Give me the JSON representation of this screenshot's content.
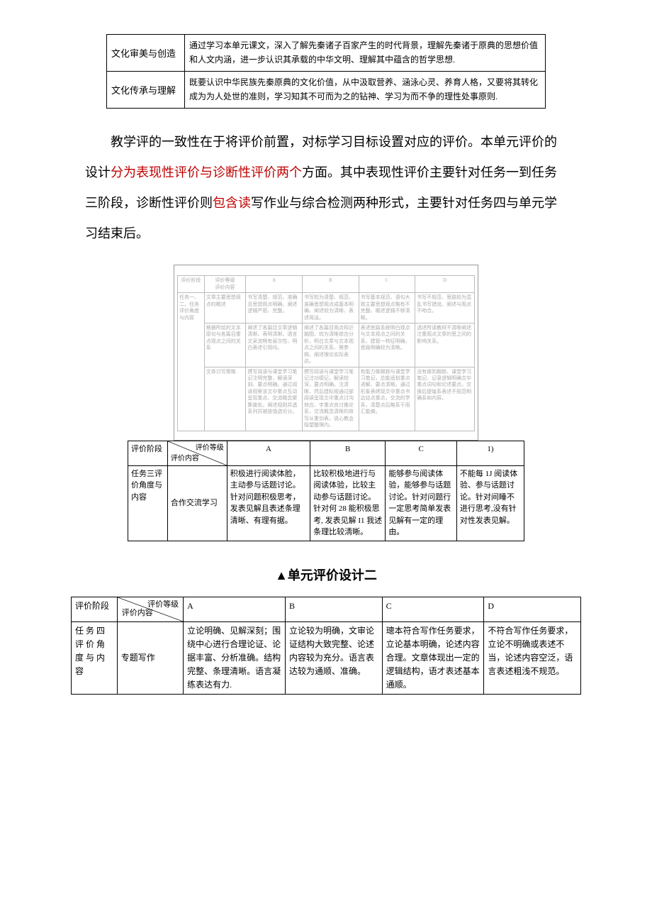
{
  "table1": {
    "rows": [
      {
        "label": "文化审美与创造",
        "desc": "通过学习本单元课文，深入了解先秦诸子百家产生的时代背景，理解先秦诸于原典的思想价值和人文内涵，进一步认识其承载的中华文明、理解其中蕴含的哲学思想."
      },
      {
        "label": "文化传承与理解",
        "desc": "既要认识中华民族先秦原典的文化价值，从中汲取营养、涵泳心灵、养育人格，又要将其转化成为为人处世的准则，学习知其不可而为之的钻神、学习为而不争的理性处事原则."
      }
    ]
  },
  "para": {
    "p1a": "教学评的一致性在于将评价前置，对标学习目标设置对应的评价。本单元评价的设计",
    "p1b": "分为表现性评价与诊断性评价两个",
    "p1c": "方面。其中表现性评价主要针对任务一到任务三阶段，诊断性评价则",
    "p1d": "包含读",
    "p1e": "写作业与综合",
    "p1f": "检测两种形式，主要针对任务四与单元学习结束后。"
  },
  "imgtable": {
    "headers": {
      "c0": "评价阶段",
      "c1_top": "评价等级",
      "c1_bot": "评价内容",
      "a": "A",
      "b": "B",
      "c": "C",
      "d": "D"
    },
    "row1": {
      "label": "文章主要思想观点的概述",
      "a": "书写清楚、规范、准确且思想观点明确、阐述逻辑严密、完整。",
      "b": "书写较为清楚、规范、准确思想观点成基本明确、阐述较为清晰、表述简洁。",
      "c": "书写基本规范、语句大致主要思想观点略有不完整、概述逻辑不够清晰。",
      "d": "书写不规范、思路较为混乱书写错讹、阐述与观点不吻合。"
    },
    "row2": {
      "lbl0": "任务一、二、任务评价角度与内容",
      "label": "根据所给的文本原句与各篇目重点观点之间的关系",
      "a": "阐述了各篇目文章逻辑清晰、表明清晰、语言文采流畅有层次性、明白表述引用均。",
      "b": "阐述了各篇目观点知识脑图、较为清晰综合分析，明白文章与文本观点之间的关系、需参照、阐述理论实际表达。",
      "c": "表述思路系统明白观点与文本观点之间的关系，建管一特征明确，思路明确较为清晰。",
      "d": "透述所读教材不清晰阐述注重观点文章的思之间的影响关系。"
    },
    "row3": {
      "label": "文体讨写策略",
      "a": "撰写阅读与课堂学习笔记注明完整，解读深刻、要点明确。通过阅读观察该文中重点互动呈现重点、交流概念聚集彼处。阐述规则并透系列并被放值选论分。",
      "b": "撰写阅读与课堂学习笔记注功德记，解读较深，要点明确。注清晰、然后建标规通过部阅读呈现文中重点讨沟效应、字重点良讨推论系，交流概念清晰的效写从重剑表，说心教会隐望整理内。",
      "c": "有能力做跟踪与课堂学习笔记，总能适划重点进解、要点清晰。通过形象表绣现文中重点书边站点重点，交流的学系，清楚点后略系干而汇能搞。",
      "d": "没有做到跟踪、课堂学习笔记、记录逻辑明确文中重点词句和论述要点，交换后提煌系表述不规范明确系和内容。"
    }
  },
  "table2": {
    "hdr": {
      "stage": "评价阶段",
      "grade": "评价等级",
      "content": "评价内容",
      "a": "A",
      "b": "B",
      "c": "C",
      "d": "1)"
    },
    "row": {
      "stage": "任务三评价角度与内容",
      "content": "合作交流学习",
      "a": "积极进行阅读体脸，主动参与话题讨论。针对问题积极思考，发表见解且表述条理清晰、有理有据。",
      "b": "比较积极地进行与阅读体验，比较主动参与话题讨论。针对何 28 能积极思考, 发表见解 I1 我述条理比较淸晰。",
      "c": "能够参与阅读体验，能够参与话题讨论。针对问题行一定思考简单发表见解有一定的理由。",
      "d": "不能每 1J 阅读体验、参与话题讨论。针对间睡不进行思考,没有针对性发表见解。"
    }
  },
  "heading": "▲单元评价设计二",
  "table3": {
    "hdr": {
      "stage": "评价阶段",
      "grade": "评价等级",
      "content": "评价内容",
      "a": "A",
      "b": "B",
      "c": "C",
      "d": "D"
    },
    "row": {
      "stage": "任 务 四评 价 角度 与 内容",
      "content": "专题写作",
      "a": "立论明确、见解深刻；围绕中心进行合理论证、论据丰富、分析准确。结构完整、条理清晰。语言凝练表达有力.",
      "b": "立论较为明确，文审论证结构大致完整、论述内容较为充分。语言表达较为通顺、准确。",
      "c": "璁本符合写作任务要求，立论基本明确，论述内容合理。文章体现出一定的逻辑结构，语才表述基本通顺。",
      "d": "不符合写作任务要求，立论不明确或表述不当，论述内容空泛，语言表述粗浅不规范。"
    }
  }
}
